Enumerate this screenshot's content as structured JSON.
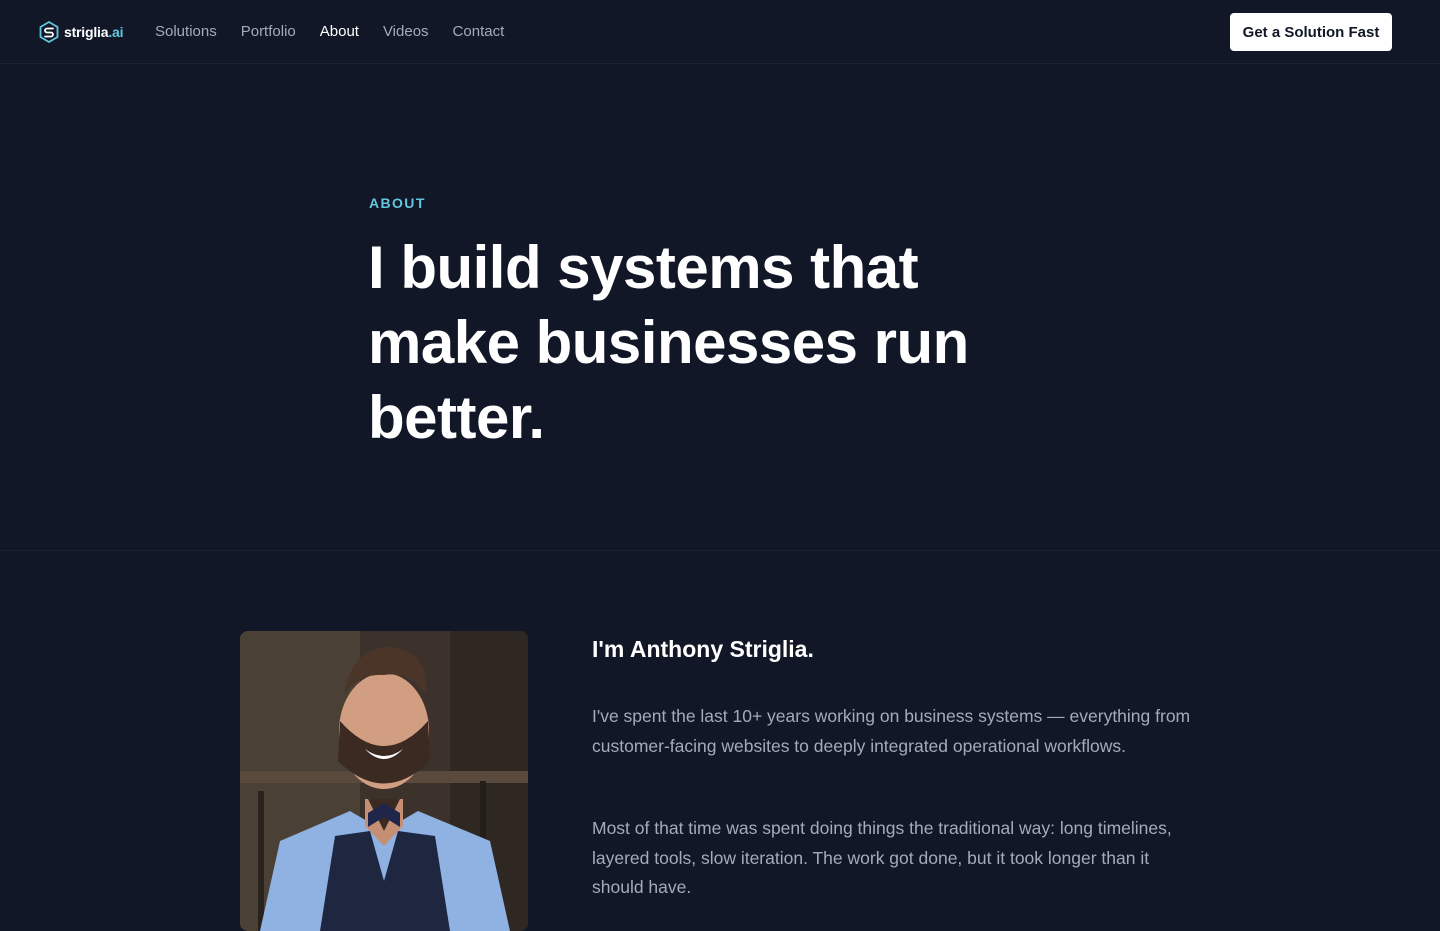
{
  "brand": {
    "name": "striglia",
    "suffix": ".ai"
  },
  "nav": {
    "items": [
      {
        "label": "Solutions",
        "active": false
      },
      {
        "label": "Portfolio",
        "active": false
      },
      {
        "label": "About",
        "active": true
      },
      {
        "label": "Videos",
        "active": false
      },
      {
        "label": "Contact",
        "active": false
      }
    ]
  },
  "cta": {
    "label": "Get a Solution Fast"
  },
  "hero": {
    "eyebrow": "ABOUT",
    "headline": "I build systems that make businesses run better."
  },
  "intro": {
    "name": "I'm Anthony Striglia.",
    "paragraphs": [
      "I've spent the last 10+ years working on business systems — everything from customer-facing websites to deeply integrated operational workflows.",
      "Most of that time was spent doing things the traditional way: long timelines, layered tools, slow iteration. The work got done, but it took longer than it should have."
    ]
  },
  "colors": {
    "background": "#111727",
    "accent": "#63c6df",
    "muted_text": "#a4abb8",
    "heading": "#ffffff"
  },
  "icons": {
    "logo": "hexagon-s-logo-icon"
  }
}
